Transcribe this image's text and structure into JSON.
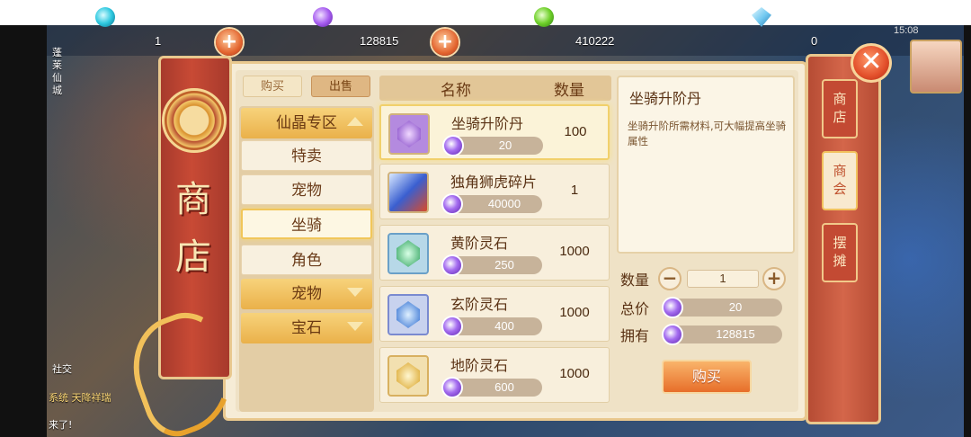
{
  "currencies": [
    {
      "icon": "teal-orb-icon",
      "value": "1"
    },
    {
      "icon": "purple-orb-icon",
      "value": "128815"
    },
    {
      "icon": "green-orb-icon",
      "value": "410222"
    },
    {
      "icon": "diamond-icon",
      "value": "0"
    }
  ],
  "status_time": "15:08",
  "scene": {
    "location_label": "蓬莱仙城",
    "social_label": "社交",
    "chat_lines": [
      "系统 天降祥瑞",
      "来了!"
    ]
  },
  "banner": {
    "title_line1": "商",
    "title_line2": "店"
  },
  "tabs": {
    "buy": "购买",
    "sell": "出售"
  },
  "categories": [
    {
      "label": "仙晶专区",
      "type": "group",
      "expanded": true
    },
    {
      "label": "特卖",
      "type": "item"
    },
    {
      "label": "宠物",
      "type": "item"
    },
    {
      "label": "坐骑",
      "type": "item",
      "selected": true
    },
    {
      "label": "角色",
      "type": "item"
    },
    {
      "label": "宠物",
      "type": "group",
      "expanded": false
    },
    {
      "label": "宝石",
      "type": "group",
      "expanded": false
    }
  ],
  "list_header": {
    "name": "名称",
    "quantity": "数量"
  },
  "items": [
    {
      "name": "坐骑升阶丹",
      "price": "20",
      "quantity": "100",
      "active": true
    },
    {
      "name": "独角狮虎碎片",
      "price": "40000",
      "quantity": "1"
    },
    {
      "name": "黄阶灵石",
      "price": "250",
      "quantity": "1000"
    },
    {
      "name": "玄阶灵石",
      "price": "400",
      "quantity": "1000"
    },
    {
      "name": "地阶灵石",
      "price": "600",
      "quantity": "1000"
    }
  ],
  "detail": {
    "title": "坐骑升阶丹",
    "description": "坐骑升阶所需材料,可大幅提高坐骑属性"
  },
  "purchase": {
    "qty_label": "数量",
    "qty_value": "1",
    "minus": "−",
    "plus": "+",
    "total_label": "总价",
    "total_value": "20",
    "own_label": "拥有",
    "own_value": "128815",
    "buy_button": "购买"
  },
  "side_tabs": [
    {
      "label": "商店",
      "active": false
    },
    {
      "label": "商会",
      "active": true
    },
    {
      "label": "摆摊",
      "active": false
    }
  ],
  "close_label": "✕",
  "colors": {
    "accent": "#e76e2a",
    "banner_red": "#c84a35",
    "panel": "#f6ecd6",
    "gold": "#f1c659"
  }
}
